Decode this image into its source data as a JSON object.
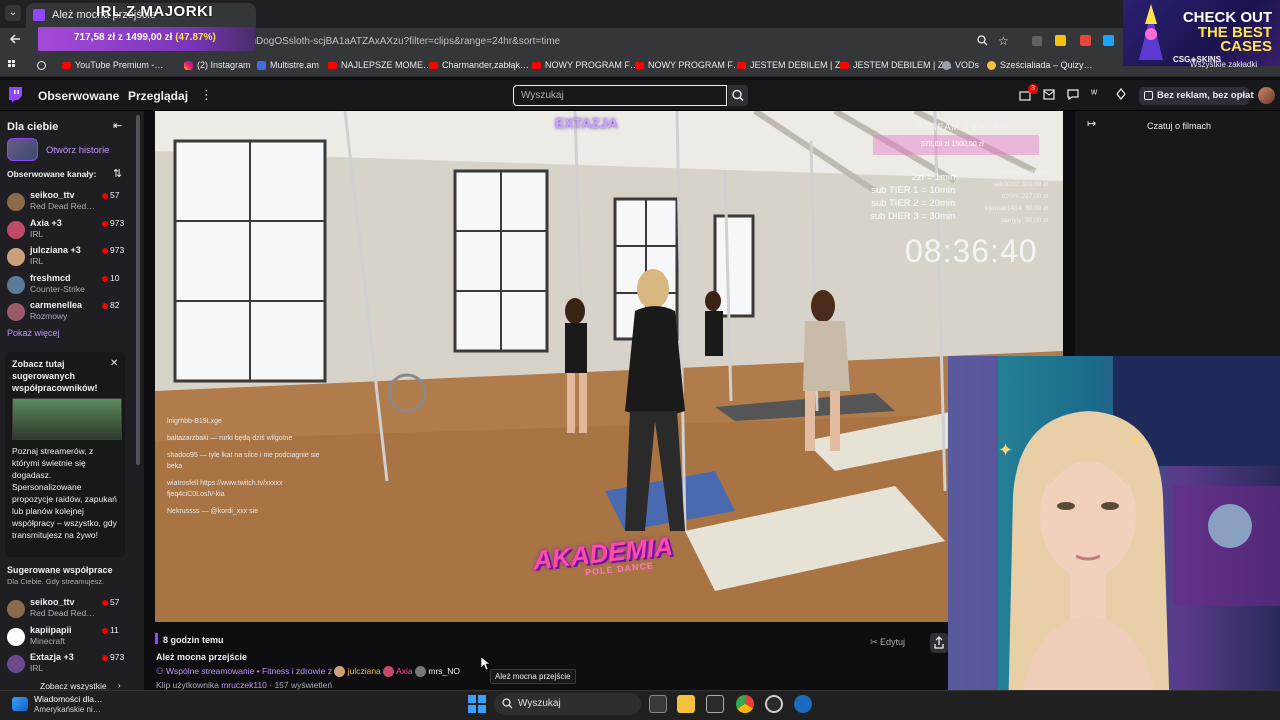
{
  "browser": {
    "tab_title": "Ależ mocna przejście",
    "overlay_title": "IRL Z MAJORKI",
    "url": "…ylishDogOSsloth-scjBA1aATZAxAXzu?filter=clips&range=24hr&sort=time",
    "donation": {
      "amount": "717,58 zł",
      "sep": "z",
      "goal": "1499,00 zł",
      "percent": "(47.87%)"
    },
    "bookmarks": [
      {
        "label": "YouTube Premium -…",
        "icon": "youtube-icon"
      },
      {
        "label": "(2) Instagram",
        "icon": "instagram-icon"
      },
      {
        "label": "Multistre.am",
        "icon": "multistream-icon"
      },
      {
        "label": "NAJLEPSZE MOME…",
        "icon": "youtube-icon"
      },
      {
        "label": "Charmander,zabłąk…",
        "icon": "youtube-icon"
      },
      {
        "label": "NOWY PROGRAM F…",
        "icon": "youtube-icon"
      },
      {
        "label": "NOWY PROGRAM F…",
        "icon": "youtube-icon"
      },
      {
        "label": "JESTEM DEBILEM | Z…",
        "icon": "youtube-icon"
      },
      {
        "label": "JESTEM DEBILEM | Z…",
        "icon": "youtube-icon"
      },
      {
        "label": "VODs",
        "icon": "globe-icon"
      },
      {
        "label": "Sześcialiada – Quizy…",
        "icon": "quiz-icon"
      }
    ],
    "all_bookmarks": "Wszystkie zakładki"
  },
  "ad": {
    "line1": "CHECK OUT",
    "line2": "THE BEST",
    "line3": "CASES",
    "brand": "CSG◈SKINS"
  },
  "nav": {
    "following": "Obserwowane",
    "browse": "Przeglądaj",
    "search_placeholder": "Wyszukaj",
    "notifications_count": "3",
    "prime_label": "Bez reklam, bez opłat"
  },
  "sidebar": {
    "title": "Dla ciebie",
    "history": "Otwórz historie",
    "followed_title": "Obserwowane kanały:",
    "channels": [
      {
        "name": "seikoo_ttv",
        "category": "Red Dead Red…",
        "viewers": "57",
        "color": "#8a6a4a"
      },
      {
        "name": "Axia +3",
        "category": "IRL",
        "viewers": "973",
        "color": "#c04a6a"
      },
      {
        "name": "julcziana +3",
        "category": "IRL",
        "viewers": "973",
        "color": "#c9a07a"
      },
      {
        "name": "freshmcd",
        "category": "Counter-Strike",
        "viewers": "10",
        "color": "#5a7a9a"
      },
      {
        "name": "carmenellea",
        "category": "Rozmowy",
        "viewers": "82",
        "color": "#9a5a6a"
      }
    ],
    "show_more": "Pokaż więcej",
    "card": {
      "title": "Zobacz tutaj sugerowanych współpracowników!",
      "text": "Poznaj streamerów, z którymi świetnie się dogadasz. Spersonalizowane propozycje raidów, zapukań lub planów kolejnej współpracy – wszystko, gdy transmitujesz na żywo!"
    },
    "suggest_title": "Sugerowane współprace",
    "suggest_sub": "Dla Ciebie. Gdy streamujesz.",
    "suggested": [
      {
        "name": "seikoo_ttv",
        "category": "Red Dead Red…",
        "viewers": "57",
        "color": "#8a6a4a"
      },
      {
        "name": "kapiipapii",
        "category": "Minecraft",
        "viewers": "11",
        "color": "#ffffff"
      },
      {
        "name": "Extazja +3",
        "category": "IRL",
        "viewers": "973",
        "color": "#6a4a8a"
      }
    ],
    "see_all": "Zobacz wszystkie"
  },
  "video": {
    "logo": "EXTAZJA",
    "stream_title": "STREAM Z EXOTIC",
    "goal_text": "578,69 zł   1500,00 zł",
    "rules": "2zł = 1min\nsub TIER 1 = 10min\nsub TIER 2 = 20min\nsub DIER 3 = 30min",
    "donors": "top donator celu\nseb9030: 300,00 zł\nrOSH: 227,00 zł\nkijomak1414: 80,00 zł\nsamyty: 50,00 zł",
    "timer": "08:36:40",
    "chat": [
      "lnigrhbb-B19Lxge",
      "baltazarzbaki — rurki będą dziś wilgotne",
      "shadoo95 — tyle lkat na silce i nie podciagnie sie beka",
      "wiatrosfell https://www.twitch.tv/xxxxx fjeq4ciC0LoslV-kia",
      "Nekrussss — @kordi_xxx sie"
    ],
    "brand": "AKADEMIA",
    "brand_sub": "POLE DANCE"
  },
  "right_panel": {
    "title": "Czatuj o filmach"
  },
  "clip": {
    "time_ago": "8 godzin temu",
    "title": "Ależ mocna przejście",
    "collab_prefix": "Wspólne streamowanie • Fitness i zdrowie z",
    "collab_1": "julcziana",
    "collab_2": "Axia",
    "collab_3": "mrs_NO",
    "clip_by_prefix": "Klip użytkownika",
    "clip_author": "mruczek110",
    "views": "· 157 wyświetleń",
    "edit": "Edytuj",
    "tooltip": "Ależ mocna przejście"
  },
  "taskbar": {
    "news_title": "Wiadomości dla…",
    "news_sub": "Amerykańskie ni…",
    "search": "Wyszukaj"
  },
  "colors": {
    "twitch_purple": "#9146ff",
    "live_red": "#eb0400",
    "link_purple": "#bf94ff"
  }
}
